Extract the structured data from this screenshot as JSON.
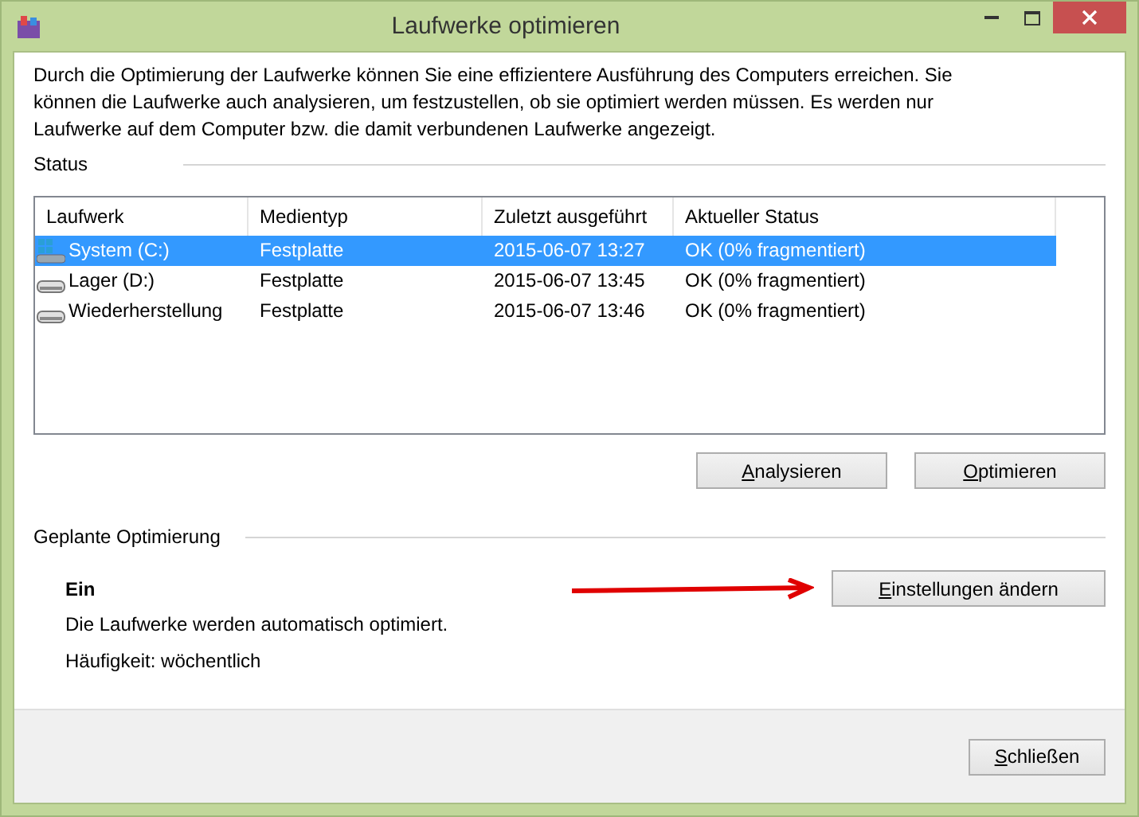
{
  "window": {
    "title": "Laufwerke optimieren"
  },
  "intro": "Durch die Optimierung der Laufwerke können Sie eine effizientere Ausführung des Computers erreichen. Sie können die Laufwerke auch analysieren, um festzustellen, ob sie optimiert werden müssen. Es werden nur Laufwerke auf dem Computer bzw. die damit verbundenen Laufwerke angezeigt.",
  "status": {
    "heading": "Status",
    "table": {
      "columns": [
        "Laufwerk",
        "Medientyp",
        "Zuletzt ausgeführt",
        "Aktueller Status"
      ],
      "rows": [
        {
          "kind": "system",
          "selected": true,
          "cells": [
            "System (C:)",
            "Festplatte",
            "2015-06-07 13:27",
            "OK (0% fragmentiert)"
          ]
        },
        {
          "kind": "drive",
          "selected": false,
          "cells": [
            "Lager (D:)",
            "Festplatte",
            "2015-06-07 13:45",
            "OK (0% fragmentiert)"
          ]
        },
        {
          "kind": "drive",
          "selected": false,
          "cells": [
            "Wiederherstellung",
            "Festplatte",
            "2015-06-07 13:46",
            "OK (0% fragmentiert)"
          ]
        }
      ]
    },
    "buttons": [
      "Analysieren",
      "Optimieren"
    ]
  },
  "schedule": {
    "heading": "Geplante Optimierung",
    "state": "Ein",
    "description": "Die Laufwerke werden automatisch optimiert.",
    "frequency": "Häufigkeit: wöchentlich",
    "button": "Einstellungen ändern"
  },
  "footer": {
    "button": "Schließen"
  }
}
